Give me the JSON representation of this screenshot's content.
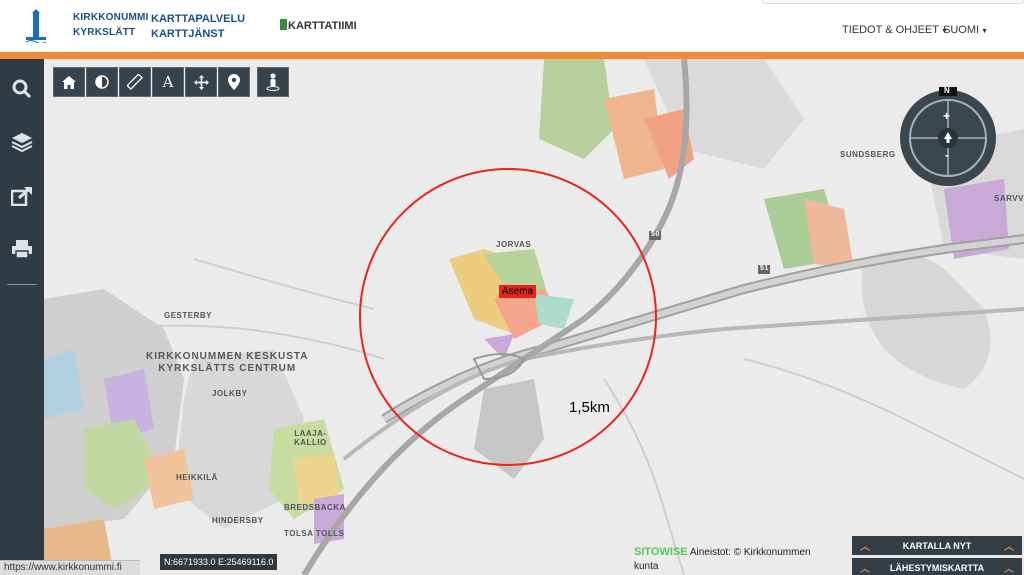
{
  "header": {
    "logo_line1": "KIRKKONUMMI",
    "logo_line2": "KYRKSLÄTT",
    "service_line1": "KARTTAPALVELU",
    "service_line2": "KARTTJÄNST",
    "team": "KARTTATIIMI",
    "nav_info": "TIEDOT & OHJEET",
    "nav_lang": "SUOMI",
    "accent": "#f08a34"
  },
  "sidebar": {
    "items": [
      {
        "icon": "search-icon"
      },
      {
        "icon": "layers-icon"
      },
      {
        "icon": "share-icon"
      },
      {
        "icon": "print-icon"
      }
    ]
  },
  "toolbar": {
    "buttons": [
      "home-icon",
      "contrast-icon",
      "measure-icon",
      "text-icon",
      "move-icon",
      "pin-icon",
      "street-view-icon"
    ],
    "text_glyph": "A"
  },
  "map": {
    "labels": {
      "jorvas": "JORVAS",
      "gesterby": "GESTERBY",
      "centre_fi": "KIRKKONUMMEN KESKUSTA",
      "centre_sv": "KYRKSLÄTTS CENTRUM",
      "jolkby": "JOLKBY",
      "laaja1": "LAAJA-",
      "laaja2": "KALLIO",
      "heikkila": "HEIKKILÄ",
      "hindersby": "HINDERSBY",
      "tolsa": "TOLSA TOLLS",
      "sundsberg": "SUNDSBERG",
      "sarvvik": "SARVVIK",
      "bredsbacka": "BREDSBACKA"
    },
    "road_numbers": [
      "50",
      "51"
    ],
    "marker": "Asema",
    "radius_label": "1,5km",
    "compass": "N"
  },
  "footer": {
    "coords": "N:6671933.0 E:25469116.0",
    "url": "https://www.kirkkonummi.fi",
    "credit_brand": "SITOWISE",
    "credit_text": "Aineistot: © Kirkkonummen kunta",
    "panel_now": "KARTALLA NYT",
    "panel_near": "LÄHESTYMISKARTTA"
  }
}
